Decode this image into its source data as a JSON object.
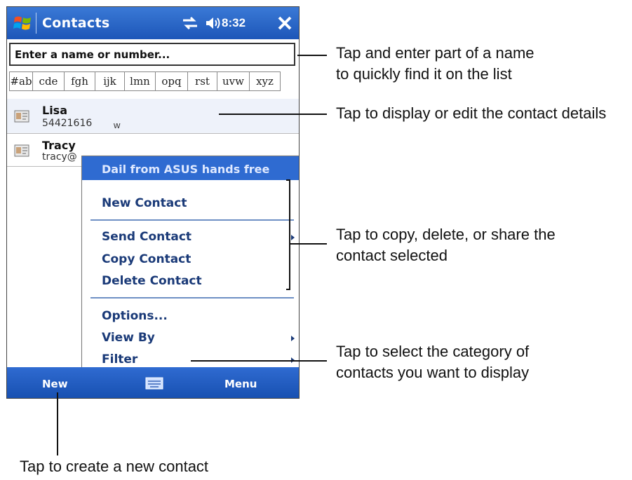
{
  "titlebar": {
    "app_title": "Contacts",
    "clock": "8:32",
    "icons": [
      "windows-logo-icon",
      "connectivity-icon",
      "volume-icon",
      "close-icon"
    ]
  },
  "search": {
    "placeholder": "Enter a name or number..."
  },
  "tabs": [
    "#ab",
    "cde",
    "fgh",
    "ijk",
    "lmn",
    "opq",
    "rst",
    "uvw",
    "xyz"
  ],
  "contacts": [
    {
      "name": "Lisa",
      "detail": "54421616",
      "tag": "w"
    },
    {
      "name": "Tracy",
      "detail": "tracy@"
    }
  ],
  "menu": {
    "highlighted": "Dail from ASUS hands free",
    "new_contact": "New Contact",
    "send_contact": "Send Contact",
    "copy_contact": "Copy Contact",
    "delete_contact": "Delete Contact",
    "options": "Options...",
    "view_by": "View By",
    "filter": "Filter"
  },
  "bottombar": {
    "left": "New",
    "right": "Menu"
  },
  "callouts": {
    "search_1": "Tap and enter part of a name",
    "search_2": "to quickly find it on the list",
    "details": "Tap to display or edit the contact details",
    "copy_1": "Tap to copy, delete, or share the",
    "copy_2": "contact selected",
    "filter_1": "Tap to select the category of",
    "filter_2": "contacts you want to display",
    "new": "Tap to create a new contact"
  },
  "colors": {
    "titlebar": "#1d56b8",
    "highlight": "#2f6bd1",
    "menu_text": "#1a3a78"
  }
}
